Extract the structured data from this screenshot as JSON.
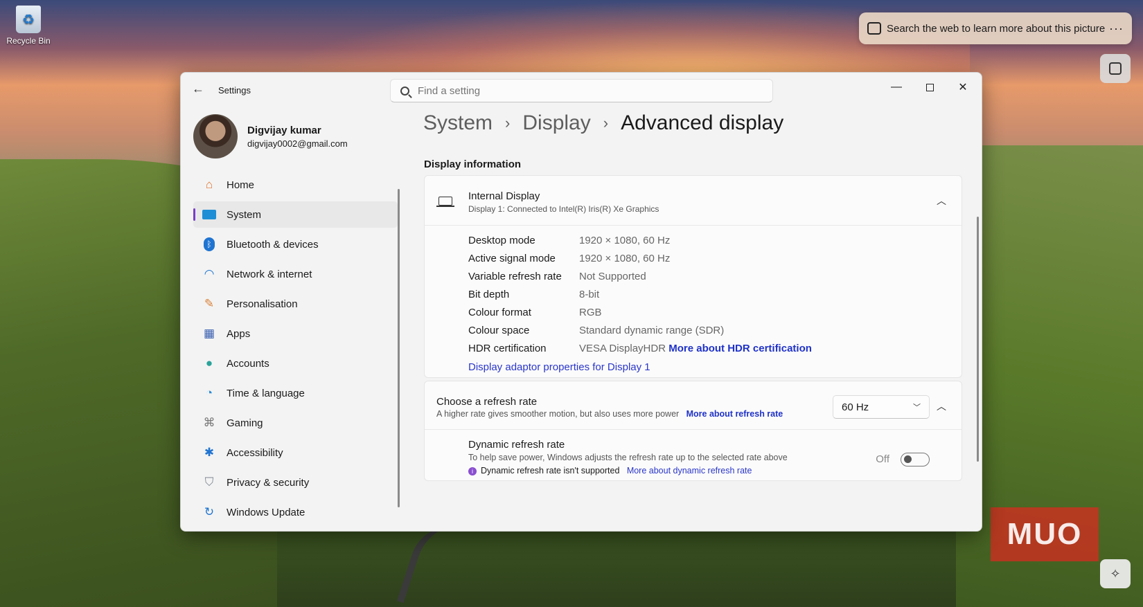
{
  "desktop": {
    "recycle_bin_label": "Recycle Bin",
    "visual_search_text": "Search the web to learn more about this picture",
    "more_glyph": "···",
    "watermark_text": "MUO"
  },
  "window": {
    "app_title": "Settings",
    "search_placeholder": "Find a setting"
  },
  "profile": {
    "name": "Digvijay kumar",
    "email": "digvijay0002@gmail.com"
  },
  "sidebar": {
    "active_index": 1,
    "accent_color": "#7a3ec9",
    "items": [
      {
        "label": "Home",
        "icon": "home-icon"
      },
      {
        "label": "System",
        "icon": "system-icon"
      },
      {
        "label": "Bluetooth & devices",
        "icon": "bluetooth-icon"
      },
      {
        "label": "Network & internet",
        "icon": "wifi-icon"
      },
      {
        "label": "Personalisation",
        "icon": "brush-icon"
      },
      {
        "label": "Apps",
        "icon": "apps-icon"
      },
      {
        "label": "Accounts",
        "icon": "accounts-icon"
      },
      {
        "label": "Time & language",
        "icon": "clock-globe-icon"
      },
      {
        "label": "Gaming",
        "icon": "gamepad-icon"
      },
      {
        "label": "Accessibility",
        "icon": "accessibility-icon"
      },
      {
        "label": "Privacy & security",
        "icon": "shield-icon"
      },
      {
        "label": "Windows Update",
        "icon": "update-icon"
      }
    ]
  },
  "breadcrumb": {
    "items": [
      "System",
      "Display"
    ],
    "current": "Advanced display"
  },
  "display_info": {
    "section_title": "Display information",
    "device_name": "Internal Display",
    "device_detail": "Display 1: Connected to Intel(R) Iris(R) Xe Graphics",
    "rows": [
      {
        "label": "Desktop mode",
        "value": "1920 × 1080, 60 Hz"
      },
      {
        "label": "Active signal mode",
        "value": "1920 × 1080, 60 Hz"
      },
      {
        "label": "Variable refresh rate",
        "value": "Not Supported"
      },
      {
        "label": "Bit depth",
        "value": "8-bit"
      },
      {
        "label": "Colour format",
        "value": "RGB"
      },
      {
        "label": "Colour space",
        "value": "Standard dynamic range (SDR)"
      },
      {
        "label": "HDR certification",
        "value": "VESA DisplayHDR"
      }
    ],
    "hdr_link": "More about HDR certification",
    "adapter_link": "Display adaptor properties for Display 1"
  },
  "refresh": {
    "title": "Choose a refresh rate",
    "subtitle": "A higher rate gives smoother motion, but also uses more power",
    "link": "More about refresh rate",
    "selected": "60 Hz",
    "dynamic_title": "Dynamic refresh rate",
    "dynamic_desc": "To help save power, Windows adjusts the refresh rate up to the selected rate above",
    "not_supported": "Dynamic refresh rate isn't supported",
    "dynamic_link": "More about dynamic refresh rate",
    "toggle_state": "Off"
  }
}
